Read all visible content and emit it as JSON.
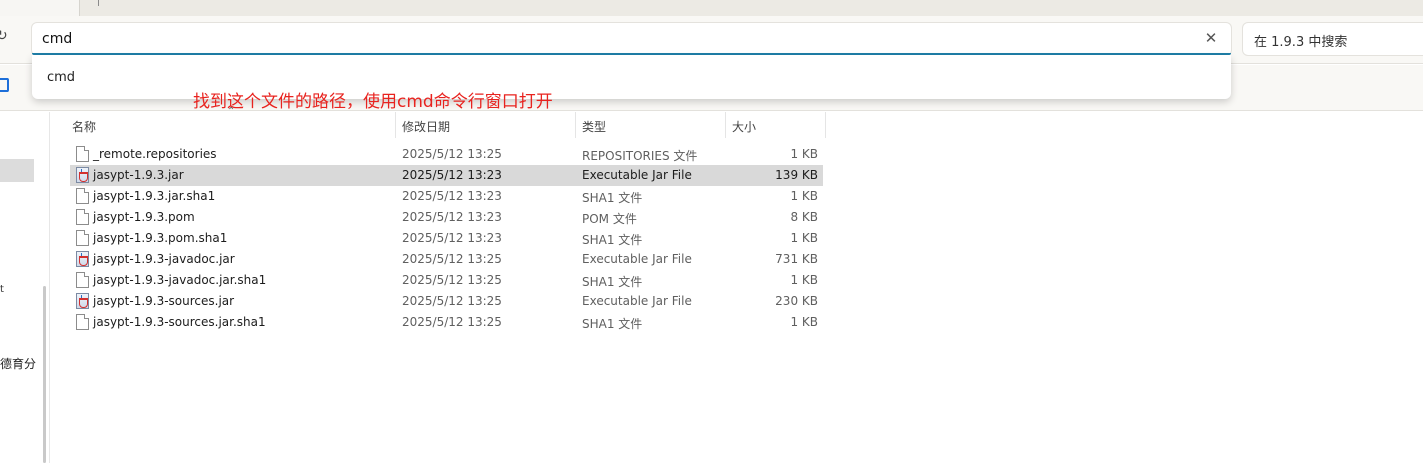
{
  "search": {
    "value": "cmd",
    "scope_placeholder": "在 1.9.3 中搜索"
  },
  "suggestions": [
    {
      "label": "cmd"
    }
  ],
  "annotation": "找到这个文件的路径，使用cmd命令行窗口打开",
  "sidebar": {
    "partial_label": "德育分",
    "partial_mark": "t"
  },
  "columns": {
    "name": "名称",
    "modified": "修改日期",
    "type": "类型",
    "size": "大小"
  },
  "files": [
    {
      "name": "_remote.repositories",
      "modified": "2025/5/12 13:25",
      "type": "REPOSITORIES 文件",
      "size": "1 KB",
      "icon": "file-icon"
    },
    {
      "name": "jasypt-1.9.3.jar",
      "modified": "2025/5/12 13:23",
      "type": "Executable Jar File",
      "size": "139 KB",
      "icon": "jar-icon",
      "selected": true
    },
    {
      "name": "jasypt-1.9.3.jar.sha1",
      "modified": "2025/5/12 13:23",
      "type": "SHA1 文件",
      "size": "1 KB",
      "icon": "file-icon"
    },
    {
      "name": "jasypt-1.9.3.pom",
      "modified": "2025/5/12 13:23",
      "type": "POM 文件",
      "size": "8 KB",
      "icon": "file-icon"
    },
    {
      "name": "jasypt-1.9.3.pom.sha1",
      "modified": "2025/5/12 13:23",
      "type": "SHA1 文件",
      "size": "1 KB",
      "icon": "file-icon"
    },
    {
      "name": "jasypt-1.9.3-javadoc.jar",
      "modified": "2025/5/12 13:25",
      "type": "Executable Jar File",
      "size": "731 KB",
      "icon": "jar-icon"
    },
    {
      "name": "jasypt-1.9.3-javadoc.jar.sha1",
      "modified": "2025/5/12 13:25",
      "type": "SHA1 文件",
      "size": "1 KB",
      "icon": "file-icon"
    },
    {
      "name": "jasypt-1.9.3-sources.jar",
      "modified": "2025/5/12 13:25",
      "type": "Executable Jar File",
      "size": "230 KB",
      "icon": "jar-icon"
    },
    {
      "name": "jasypt-1.9.3-sources.jar.sha1",
      "modified": "2025/5/12 13:25",
      "type": "SHA1 文件",
      "size": "1 KB",
      "icon": "file-icon"
    }
  ]
}
